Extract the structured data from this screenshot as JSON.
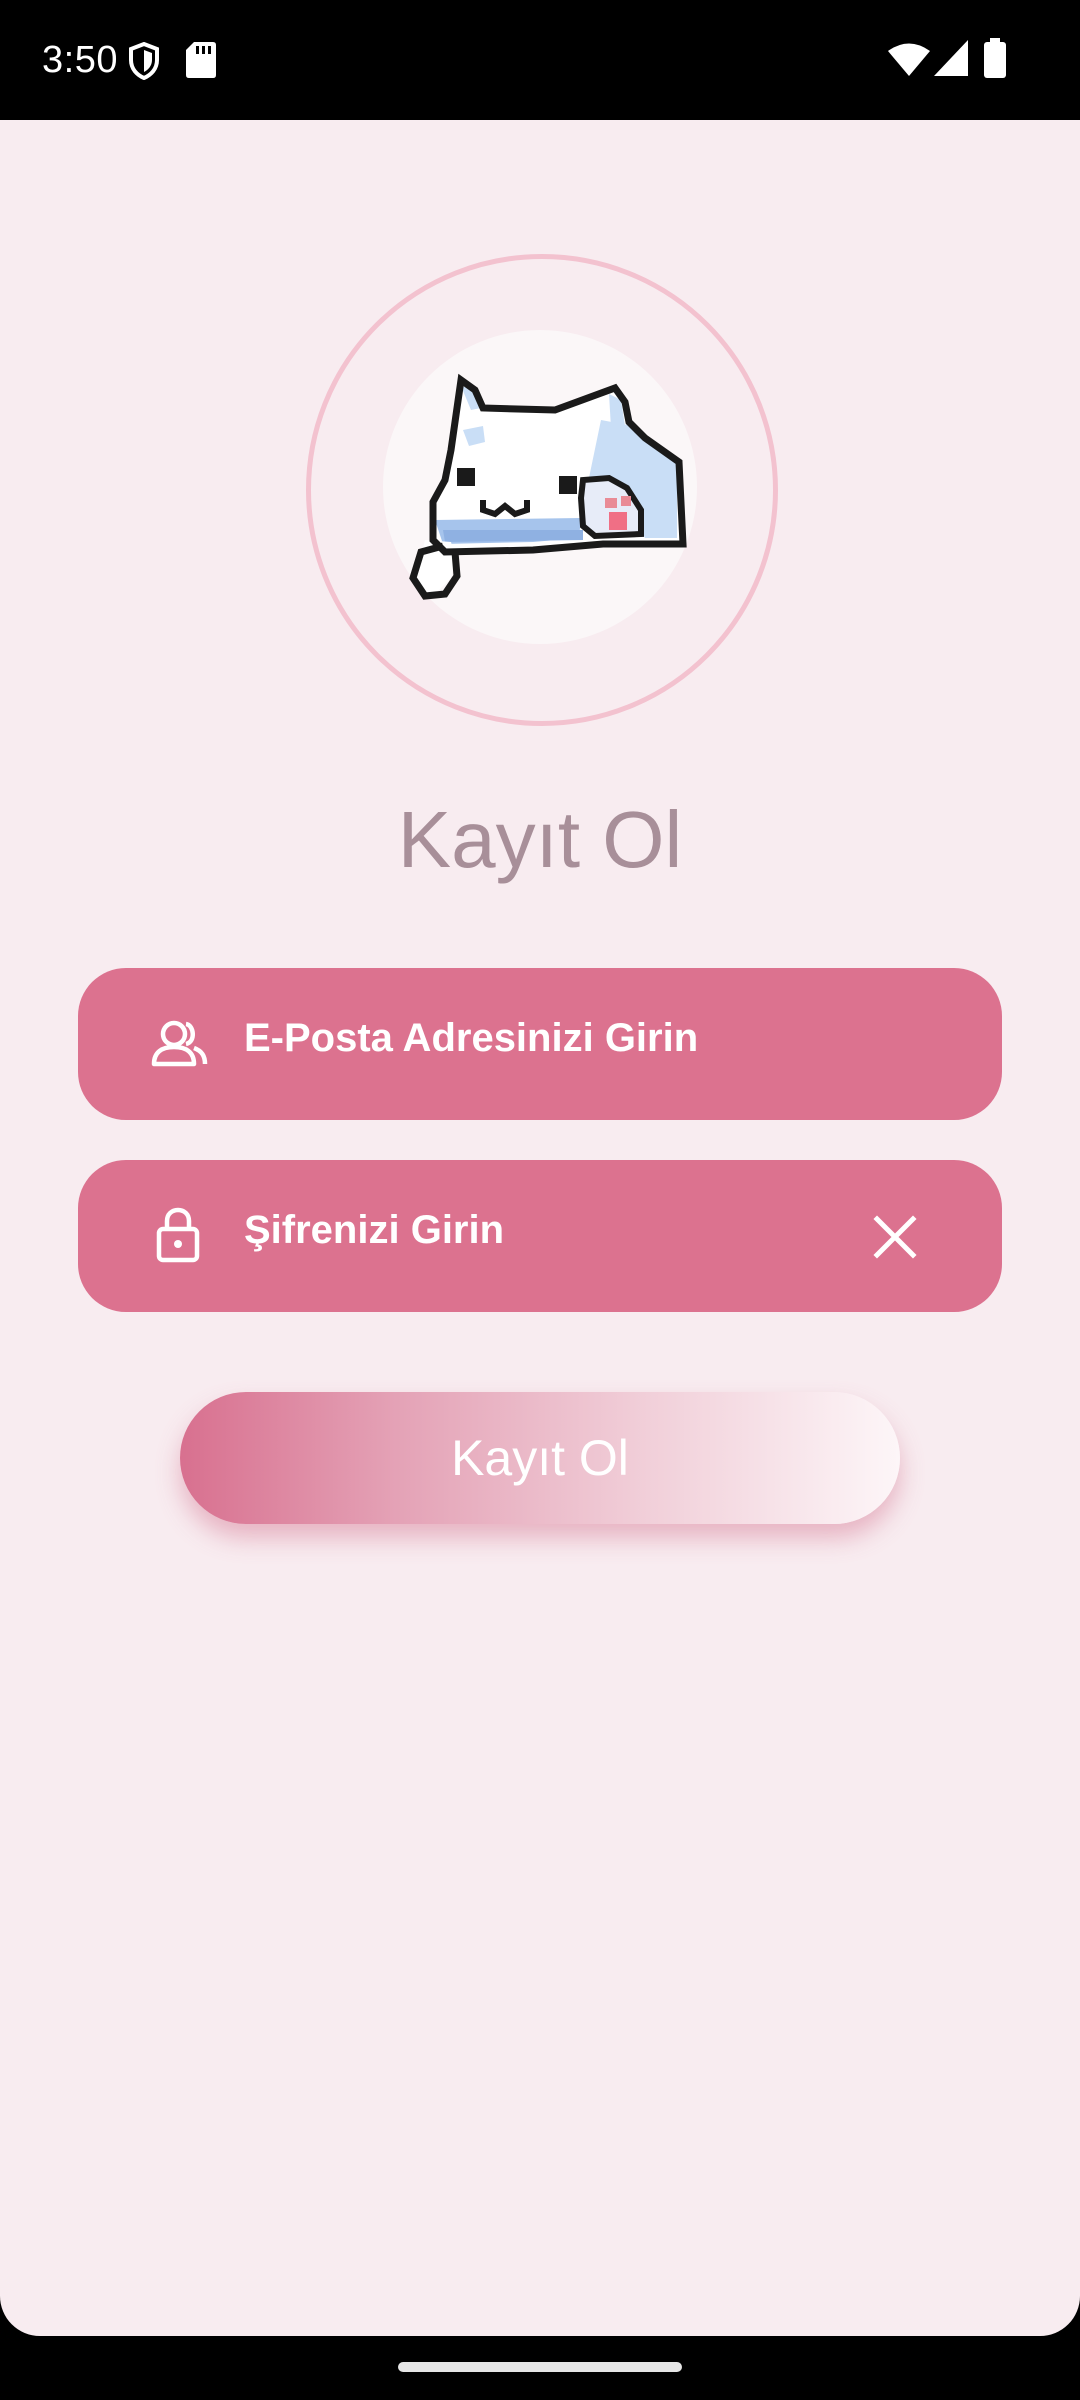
{
  "status_bar": {
    "time": "3:50",
    "left_icons": [
      "shield-icon",
      "sd-card-icon"
    ],
    "right_icons": [
      "wifi-icon",
      "signal-icon",
      "battery-icon"
    ]
  },
  "avatar": {
    "icon": "pixel-cat-icon"
  },
  "page": {
    "title": "Kayıt Ol"
  },
  "email_field": {
    "icon": "users-icon",
    "placeholder": "E-Posta Adresinizi Girin"
  },
  "password_field": {
    "icon": "lock-icon",
    "placeholder": "Şifrenizi Girin",
    "clear_icon": "close-icon"
  },
  "register_button": {
    "label": "Kayıt Ol"
  },
  "colors": {
    "background": "#f8ecf0",
    "field": "#dc728f",
    "ring": "#f3c2cf",
    "title": "#a88f99"
  }
}
